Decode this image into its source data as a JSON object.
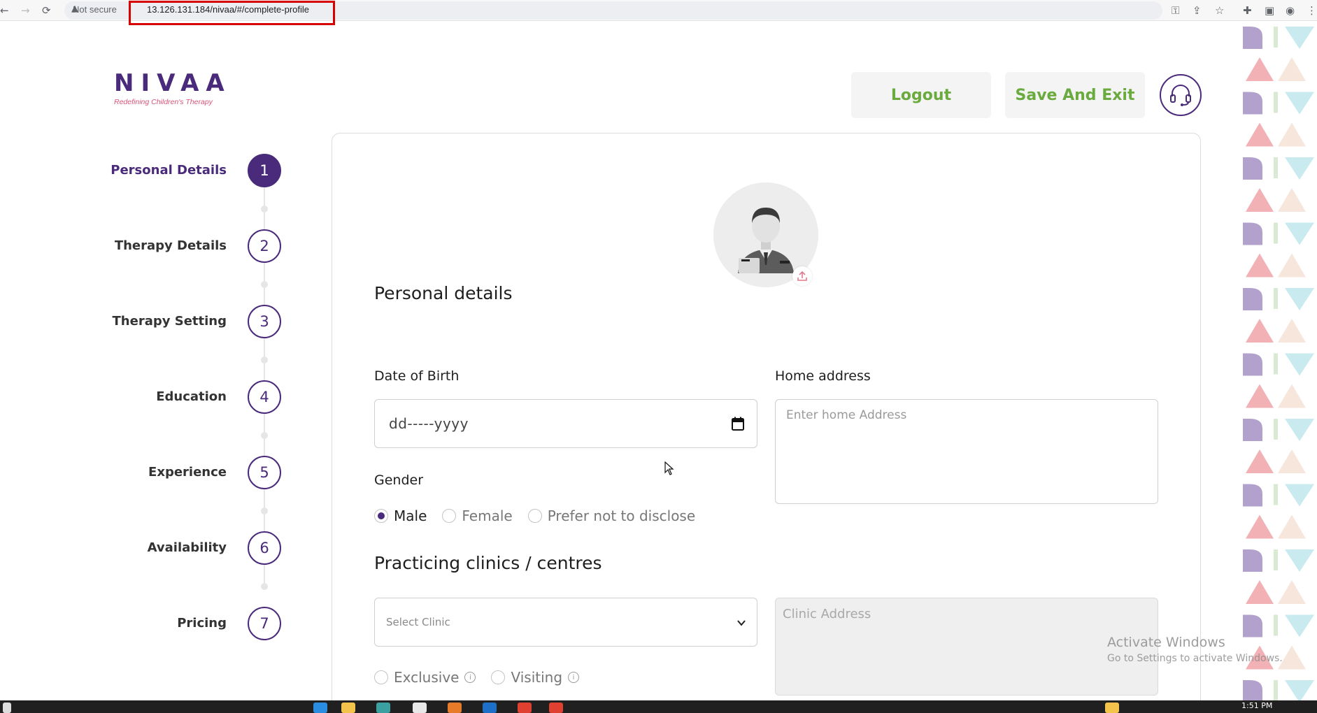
{
  "browser": {
    "not_secure": "Not secure",
    "url": "13.126.131.184/nivaa/#/complete-profile"
  },
  "brand": {
    "name": "NIVAA",
    "tagline": "Redefining Children's Therapy",
    "primary_color": "#4a2a7a",
    "accent_color": "#6aaa3f",
    "tagline_color": "#d9547a"
  },
  "header": {
    "logout_label": "Logout",
    "save_exit_label": "Save And Exit",
    "support_icon": "headset-icon"
  },
  "stepper": {
    "steps": [
      {
        "number": "1",
        "label": "Personal Details",
        "active": true
      },
      {
        "number": "2",
        "label": "Therapy Details",
        "active": false
      },
      {
        "number": "3",
        "label": "Therapy Setting",
        "active": false
      },
      {
        "number": "4",
        "label": "Education",
        "active": false
      },
      {
        "number": "5",
        "label": "Experience",
        "active": false
      },
      {
        "number": "6",
        "label": "Availability",
        "active": false
      },
      {
        "number": "7",
        "label": "Pricing",
        "active": false
      }
    ]
  },
  "form": {
    "personal_title": "Personal details",
    "dob_label": "Date of Birth",
    "dob_value": "dd-----yyyy",
    "home_address_label": "Home address",
    "home_address_placeholder": "Enter home Address",
    "gender_label": "Gender",
    "gender_options": [
      "Male",
      "Female",
      "Prefer not to disclose"
    ],
    "gender_selected": "Male",
    "clinics_title": "Practicing clinics / centres",
    "clinic_select_placeholder": "Select Clinic",
    "clinic_address_placeholder": "Clinic Address",
    "clinic_type_options": [
      "Exclusive",
      "Visiting"
    ]
  },
  "watermark": {
    "title": "Activate Windows",
    "subtitle": "Go to Settings to activate Windows."
  },
  "taskbar": {
    "time": "1:51 PM"
  }
}
